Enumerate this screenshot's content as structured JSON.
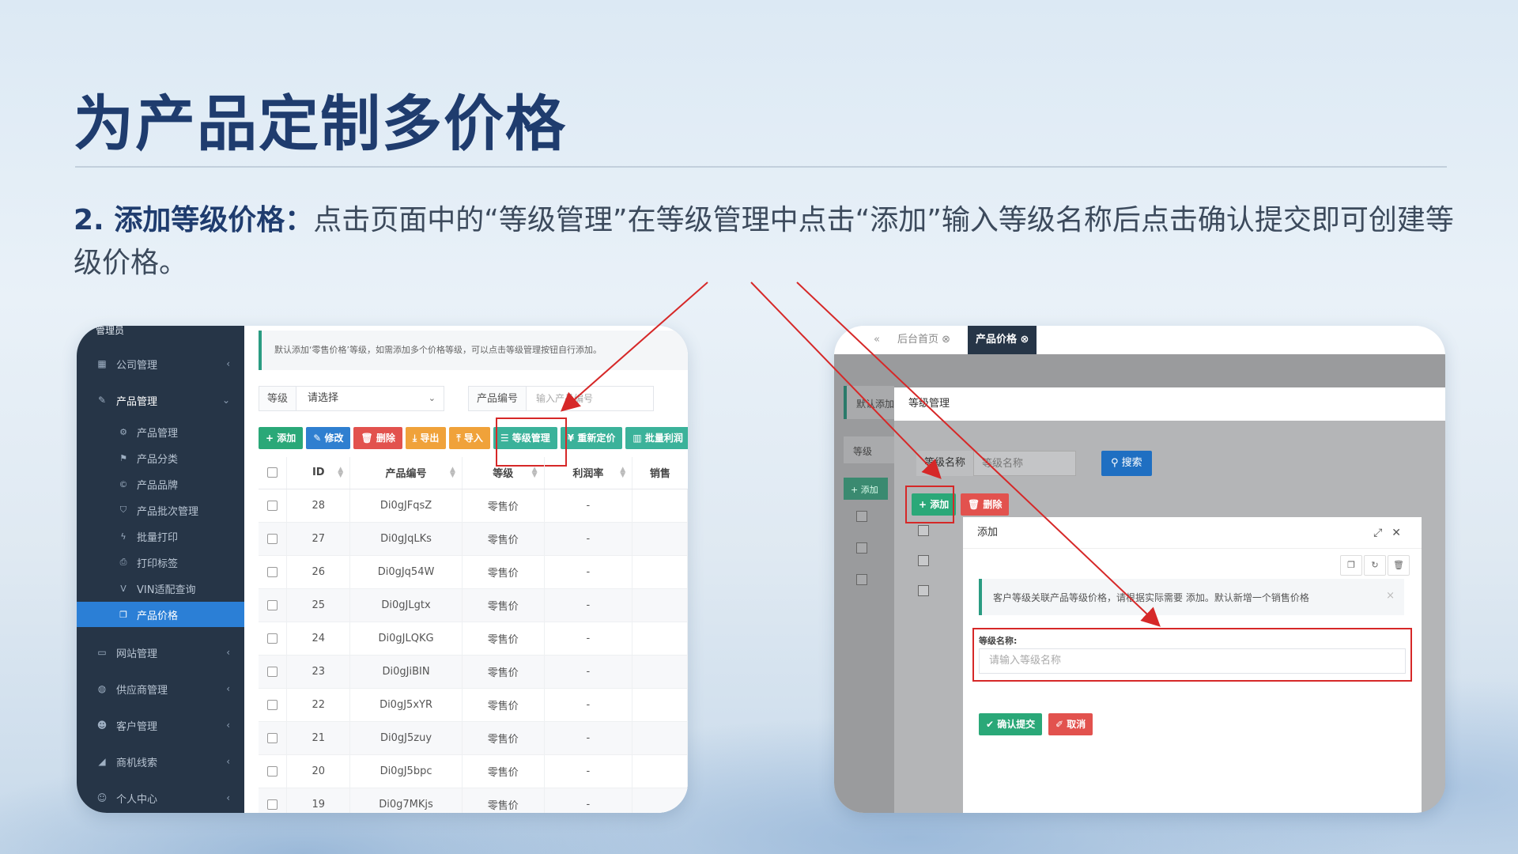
{
  "slide": {
    "title": "为产品定制多价格",
    "desc_lead": "2. 添加等级价格：",
    "desc_body": "点击页面中的“等级管理”在等级管理中点击“添加”输入等级名称后点击确认提交即可创建等级价格。"
  },
  "colors": {
    "title": "#1f3c6e",
    "sidebar": "#263547",
    "active": "#2b7fd6",
    "highlight": "#d62828"
  },
  "left": {
    "brand": "管理员",
    "menu": [
      {
        "label": "公司管理",
        "icon": "bank-icon"
      },
      {
        "label": "产品管理",
        "icon": "wrench-icon"
      },
      {
        "label": "网站管理",
        "icon": "monitor-icon"
      },
      {
        "label": "供应商管理",
        "icon": "globe-icon"
      },
      {
        "label": "客户管理",
        "icon": "users-icon"
      },
      {
        "label": "商机线索",
        "icon": "area-chart-icon"
      },
      {
        "label": "个人中心",
        "icon": "user-icon"
      }
    ],
    "submenu": [
      {
        "label": "产品管理",
        "icon": "cogs-icon"
      },
      {
        "label": "产品分类",
        "icon": "flag-icon"
      },
      {
        "label": "产品品牌",
        "icon": "copyright-icon"
      },
      {
        "label": "产品批次管理",
        "icon": "shield-icon"
      },
      {
        "label": "批量打印",
        "icon": "bolt-icon"
      },
      {
        "label": "打印标签",
        "icon": "print-icon"
      },
      {
        "label": "VIN适配查询",
        "icon": "vimeo-icon"
      },
      {
        "label": "产品价格",
        "icon": "copy-icon"
      }
    ],
    "notice": "默认添加‘零售价格’等级，如需添加多个价格等级，可以点击等级管理按钮自行添加。",
    "filter": {
      "level_label": "等级",
      "level_value": "请选择",
      "code_label": "产品编号",
      "code_placeholder": "输入产品编号"
    },
    "toolbar": [
      "+ 添加",
      "✎ 修改",
      "🗑 删除",
      "⤓ 导出",
      "⤒ 导入",
      "☰ 等级管理",
      "¥ 重新定价",
      "▥ 批量利润"
    ],
    "columns": [
      "ID",
      "产品编号",
      "等级",
      "利润率",
      "销售"
    ],
    "rows": [
      [
        "28",
        "Di0gJFqsZ",
        "零售价",
        "-"
      ],
      [
        "27",
        "Di0gJqLKs",
        "零售价",
        "-"
      ],
      [
        "26",
        "Di0gJq54W",
        "零售价",
        "-"
      ],
      [
        "25",
        "Di0gJLgtx",
        "零售价",
        "-"
      ],
      [
        "24",
        "Di0gJLQKG",
        "零售价",
        "-"
      ],
      [
        "23",
        "Di0gJiBIN",
        "零售价",
        "-"
      ],
      [
        "22",
        "Di0gJ5xYR",
        "零售价",
        "-"
      ],
      [
        "21",
        "Di0gJ5zuy",
        "零售价",
        "-"
      ],
      [
        "20",
        "Di0gJ5bpc",
        "零售价",
        "-"
      ],
      [
        "19",
        "Di0g7MKjs",
        "零售价",
        "-"
      ]
    ]
  },
  "right": {
    "tabs": [
      "后台首页",
      "产品价格"
    ],
    "bg_notice": "默认添加",
    "bg_level": "等级",
    "bg_add": "+ 添加",
    "layer_title": "等级管理",
    "level_name_label": "等级名称",
    "level_name_placeholder": "等级名称",
    "search": "搜索",
    "add": "+ 添加",
    "delete": "删除",
    "modal": {
      "title": "添加",
      "notice": "客户等级关联产品等级价格，请根据实际需要 添加。默认新增一个销售价格",
      "field_label": "等级名称:",
      "field_placeholder": "请输入等级名称",
      "confirm": "✔ 确认提交",
      "cancel": "✐ 取消"
    }
  }
}
